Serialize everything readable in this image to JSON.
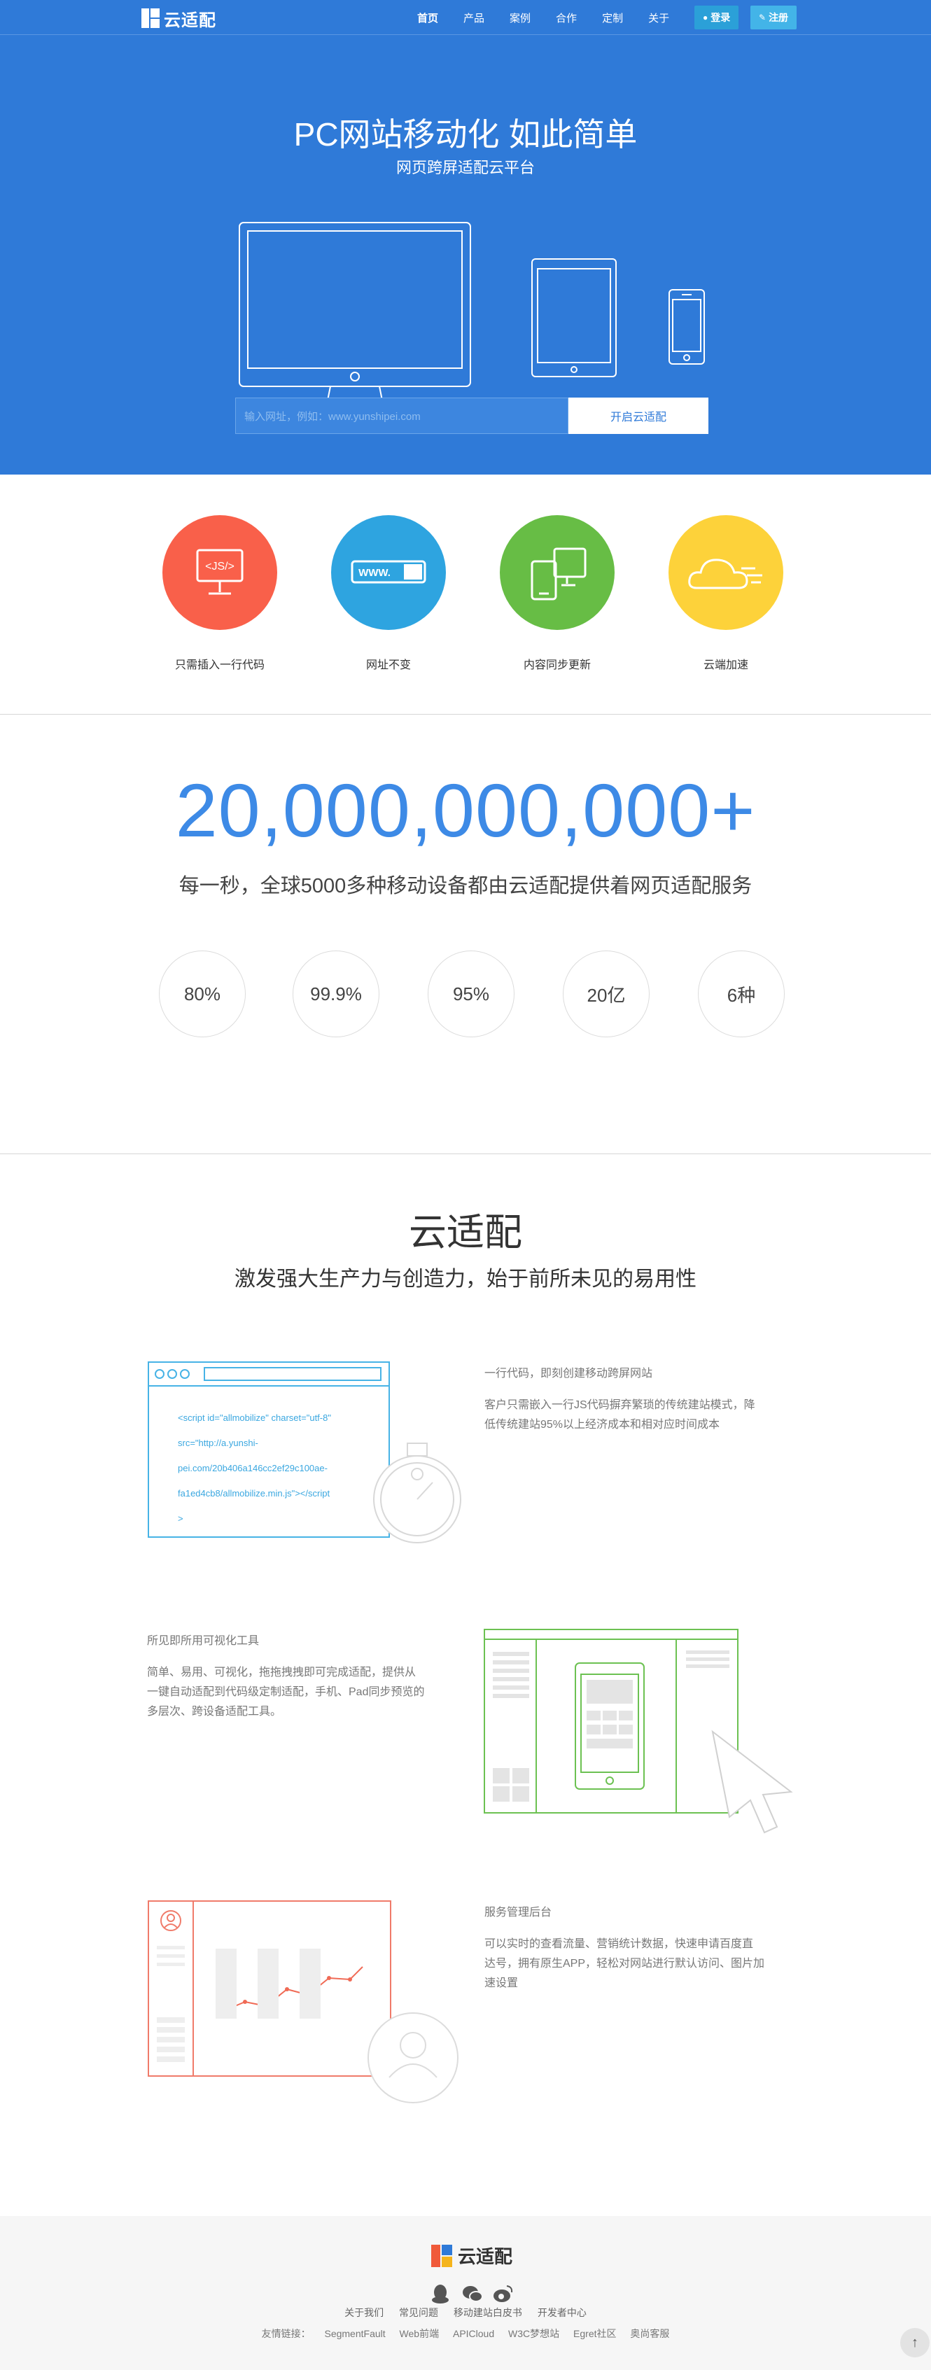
{
  "header": {
    "logo_text": "云适配",
    "nav": [
      "首页",
      "产品",
      "案例",
      "合作",
      "定制",
      "关于"
    ],
    "login_label": "登录",
    "register_label": "注册"
  },
  "hero": {
    "title": "PC网站移动化 如此简单",
    "subtitle": "网页跨屏适配云平台",
    "input_placeholder": "输入网址，例如：www.yunshipei.com",
    "button_label": "开启云适配"
  },
  "features": [
    {
      "label": "只需插入一行代码",
      "color": "#f9604a",
      "icon": "js-monitor-icon",
      "glyph": "<JS/>"
    },
    {
      "label": "网址不变",
      "color": "#2ea4e0",
      "icon": "url-bar-icon",
      "glyph": "WWW."
    },
    {
      "label": "内容同步更新",
      "color": "#67bd45",
      "icon": "sync-devices-icon",
      "glyph": ""
    },
    {
      "label": "云端加速",
      "color": "#fdd23a",
      "icon": "cloud-icon",
      "glyph": ""
    }
  ],
  "stats": {
    "big_number": "20,000,000,000+",
    "subtitle": "每一秒，全球5000多种移动设备都由云适配提供着网页适配服务",
    "circles": [
      "80%",
      "99.9%",
      "95%",
      "20亿",
      "6种"
    ]
  },
  "product": {
    "title": "云适配",
    "subtitle": "激发强大生产力与创造力，始于前所未见的易用性",
    "code_lines": [
      "<script id=\"allmobilize\" charset=\"utf-8\"",
      "src=\"http://a.yunshi-",
      "pei.com/20b406a146cc2ef29c100ae-",
      "fa1ed4cb8/allmobilize.min.js\"></script",
      ">"
    ],
    "items": [
      {
        "title": "一行代码，即刻创建移动跨屏网站",
        "desc": [
          "客户只需嵌入一行JS代码摒弃繁琐的传统建站模式，降",
          "低传统建站95%以上经济成本和相对应时间成本"
        ]
      },
      {
        "title": "所见即所用可视化工具",
        "desc": [
          "简单、易用、可视化，拖拖拽拽即可完成适配，提供从",
          "一键自动适配到代码级定制适配，手机、Pad同步预览的",
          "多层次、跨设备适配工具。"
        ]
      },
      {
        "title": "服务管理后台",
        "desc": [
          "可以实时的查看流量、营销统计数据，快速申请百度直",
          "达号，拥有原生APP，轻松对网站进行默认访问、图片加",
          "速设置"
        ]
      }
    ]
  },
  "footer": {
    "logo_text": "云适配",
    "links": [
      "关于我们",
      "常见问题",
      "移动建站白皮书",
      "开发者中心"
    ],
    "friend_label": "友情链接：",
    "friends": [
      "SegmentFault",
      "Web前端",
      "APICloud",
      "W3C梦想站",
      "Egret社区",
      "奥尚客服"
    ]
  },
  "colors": {
    "brand_blue": "#2f7ad8",
    "number_blue": "#3d8ae6",
    "code_blue": "#3aa7e0",
    "tool_green": "#67bd45",
    "admin_red": "#f07b6a"
  }
}
